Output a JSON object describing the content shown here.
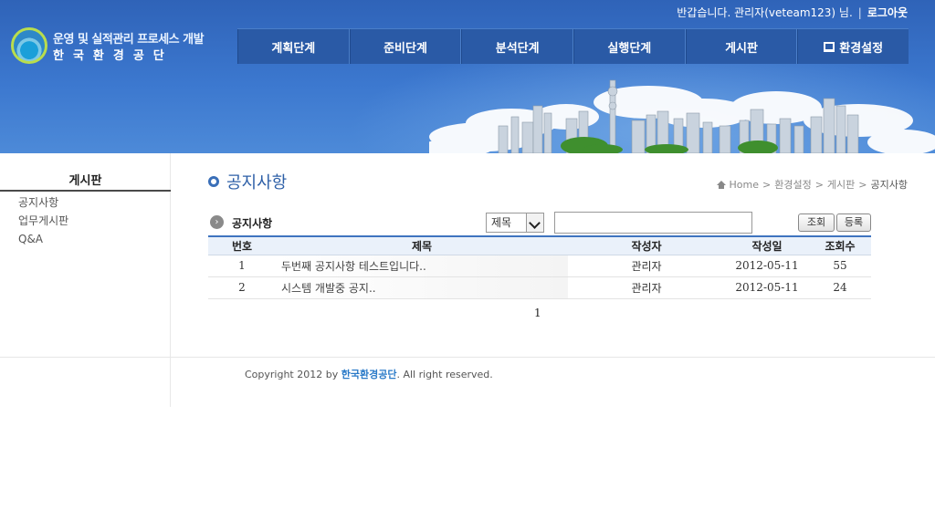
{
  "header": {
    "greeting": "반갑습니다. 관리자(veteam123) 님.",
    "separator": "|",
    "logout": "로그아웃",
    "logo_line1": "운영 및 실적관리 프로세스 개발",
    "logo_line2": "한국환경공단",
    "nav": [
      "계획단계",
      "준비단계",
      "분석단계",
      "실행단계",
      "게시판",
      "환경설정"
    ]
  },
  "sidebar": {
    "title": "게시판",
    "items": [
      "공지사항",
      "업무게시판",
      "Q&A"
    ]
  },
  "page": {
    "title": "공지사항",
    "breadcrumb": [
      "Home",
      "환경설정",
      "게시판",
      "공지사항"
    ],
    "breadcrumb_sep": ">"
  },
  "board": {
    "label": "공지사항",
    "badge": "›",
    "search_field": "제목",
    "search_value": "",
    "search_button": "조회",
    "register_button": "등록",
    "columns": [
      "번호",
      "제목",
      "작성자",
      "작성일",
      "조회수"
    ],
    "rows": [
      {
        "no": "1",
        "title": "두번째 공지사항 테스트입니다..",
        "author": "관리자",
        "date": "2012-05-11",
        "views": "55"
      },
      {
        "no": "2",
        "title": "시스템 개발중 공지..",
        "author": "관리자",
        "date": "2012-05-11",
        "views": "24"
      }
    ],
    "page": "1"
  },
  "footer": {
    "prefix": "Copyright 2012 by ",
    "brand": "한국환경공단",
    "suffix": ". All right reserved."
  },
  "colors": {
    "header_blue": "#3c78cf",
    "nav_blue": "#2a5aa6",
    "accent": "#2d5fa7",
    "table_header_bg": "#eaf1fa"
  },
  "icons": [
    "monitor-icon",
    "home-icon",
    "arrow-circle-icon",
    "chevron-down-icon"
  ]
}
